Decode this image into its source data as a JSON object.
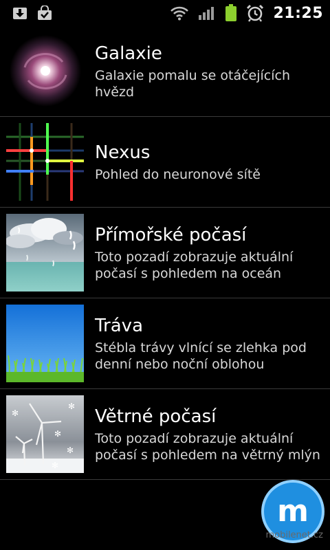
{
  "status_bar": {
    "time": "21:25",
    "left_icons": [
      "download-icon",
      "shopping-bag-check-icon"
    ],
    "right_icons": [
      "wifi-icon",
      "signal-icon",
      "battery-icon",
      "alarm-icon"
    ]
  },
  "wallpapers": [
    {
      "title": "Galaxie",
      "description": "Galaxie pomalu se otáčejících hvězd",
      "thumbnail": "galaxy"
    },
    {
      "title": "Nexus",
      "description": "Pohled do neuronové sítě",
      "thumbnail": "nexus"
    },
    {
      "title": "Přímořské počasí",
      "description": "Toto pozadí zobrazuje aktuální počasí s pohledem na oceán",
      "thumbnail": "ocean-weather"
    },
    {
      "title": "Tráva",
      "description": "Stébla trávy vlnící se zlehka pod denní nebo noční oblohou",
      "thumbnail": "grass"
    },
    {
      "title": "Větrné počasí",
      "description": "Toto pozadí zobrazuje aktuální počasí s pohledem na větrný mlýn",
      "thumbnail": "windmill-weather"
    }
  ],
  "watermark": {
    "text": "mobilenet.cz",
    "logo_letter": "m"
  },
  "colors": {
    "background": "#000000",
    "divider": "#3a3a3a",
    "battery": "#8ccf2e",
    "watermark_blue": "#1f8fe0"
  }
}
